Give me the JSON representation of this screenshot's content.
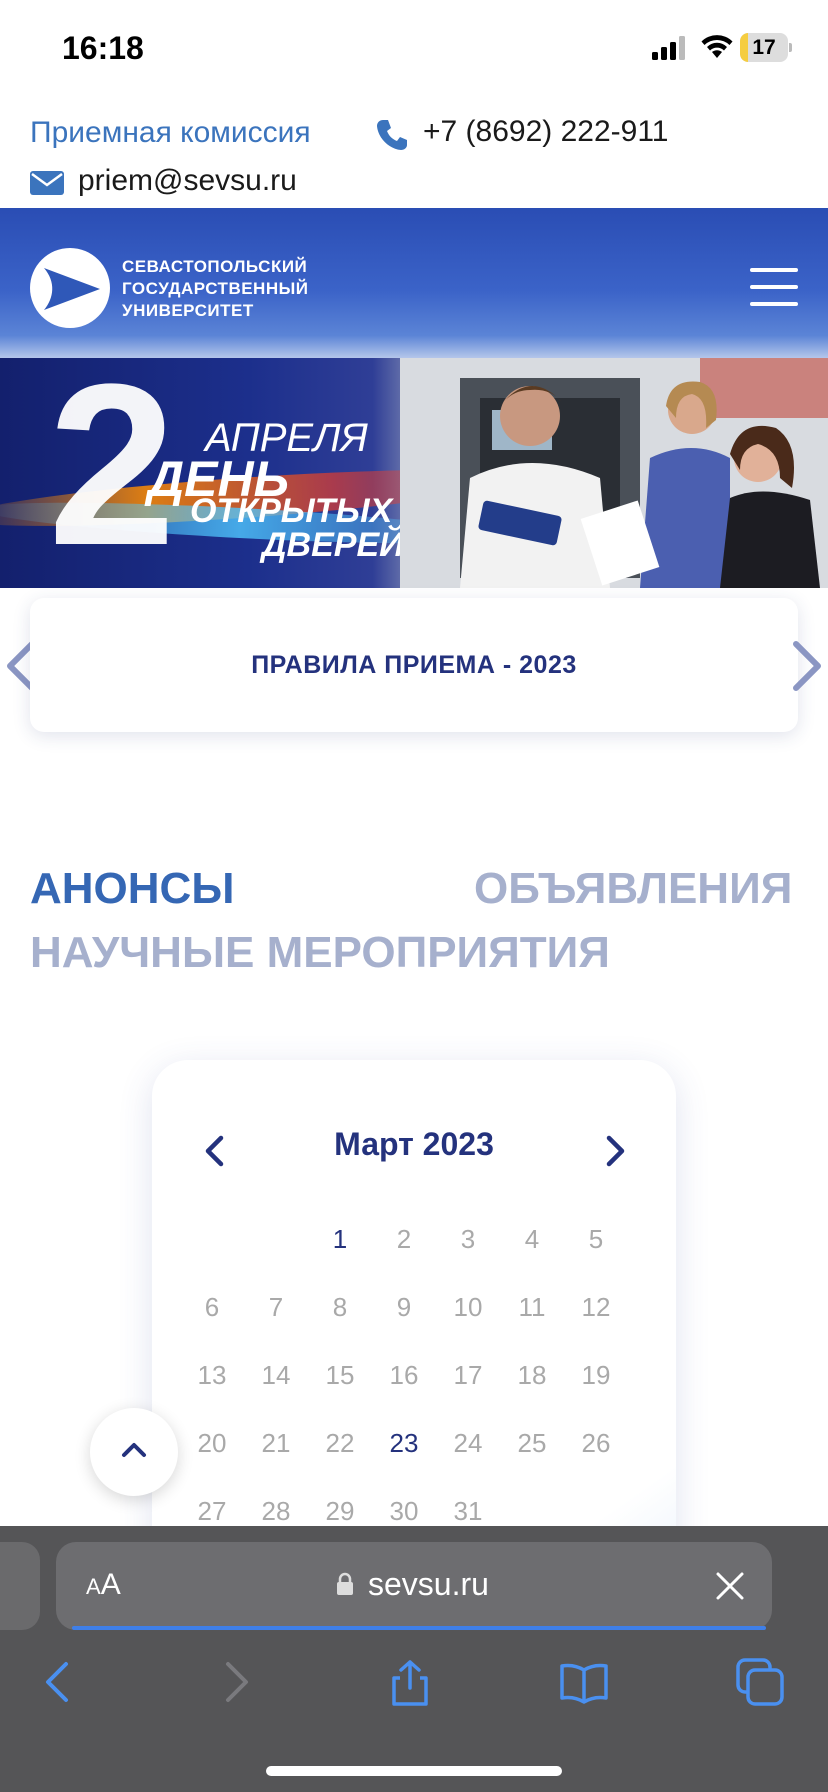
{
  "status_bar": {
    "time": "16:18",
    "battery": "17",
    "battery_level": 0.17
  },
  "contacts": {
    "admissions_label": "Приемная комиссия",
    "phone": "+7 (8692) 222-911",
    "email": "priem@sevsu.ru"
  },
  "header": {
    "logo_lines": [
      "СЕВАСТОПОЛЬСКИЙ",
      "ГОСУДАРСТВЕННЫЙ",
      "УНИВЕРСИТЕТ"
    ]
  },
  "banner": {
    "number": "2",
    "month": "АПРЕЛЯ",
    "line1": "ДЕНЬ",
    "line2": "ОТКРЫТЫХ",
    "line3": "ДВЕРЕЙ"
  },
  "rules_card": {
    "title": "ПРАВИЛА ПРИЕМА - 2023"
  },
  "tabs": [
    {
      "label": "АНОНСЫ",
      "active": true
    },
    {
      "label": "ОБЪЯВЛЕНИЯ",
      "active": false
    },
    {
      "label": "НАУЧНЫЕ МЕРОПРИЯТИЯ",
      "active": false
    }
  ],
  "calendar": {
    "month_title": "Март 2023",
    "weeks": [
      [
        "",
        "",
        "1",
        "2",
        "3",
        "4",
        "5"
      ],
      [
        "6",
        "7",
        "8",
        "9",
        "10",
        "11",
        "12"
      ],
      [
        "13",
        "14",
        "15",
        "16",
        "17",
        "18",
        "19"
      ],
      [
        "20",
        "21",
        "22",
        "23",
        "24",
        "25",
        "26"
      ],
      [
        "27",
        "28",
        "29",
        "30",
        "31",
        "",
        ""
      ]
    ],
    "highlighted_days": [
      "1",
      "23"
    ]
  },
  "browser": {
    "text_size_small": "A",
    "text_size_large": "A",
    "url": "sevsu.ru",
    "toolbar_icons": [
      "back-icon",
      "forward-icon",
      "share-icon",
      "bookmarks-icon",
      "tabs-icon"
    ]
  },
  "colors": {
    "brand_blue": "#3567b4",
    "dark_navy": "#24327d",
    "inactive_tab": "#a6b0cd"
  }
}
